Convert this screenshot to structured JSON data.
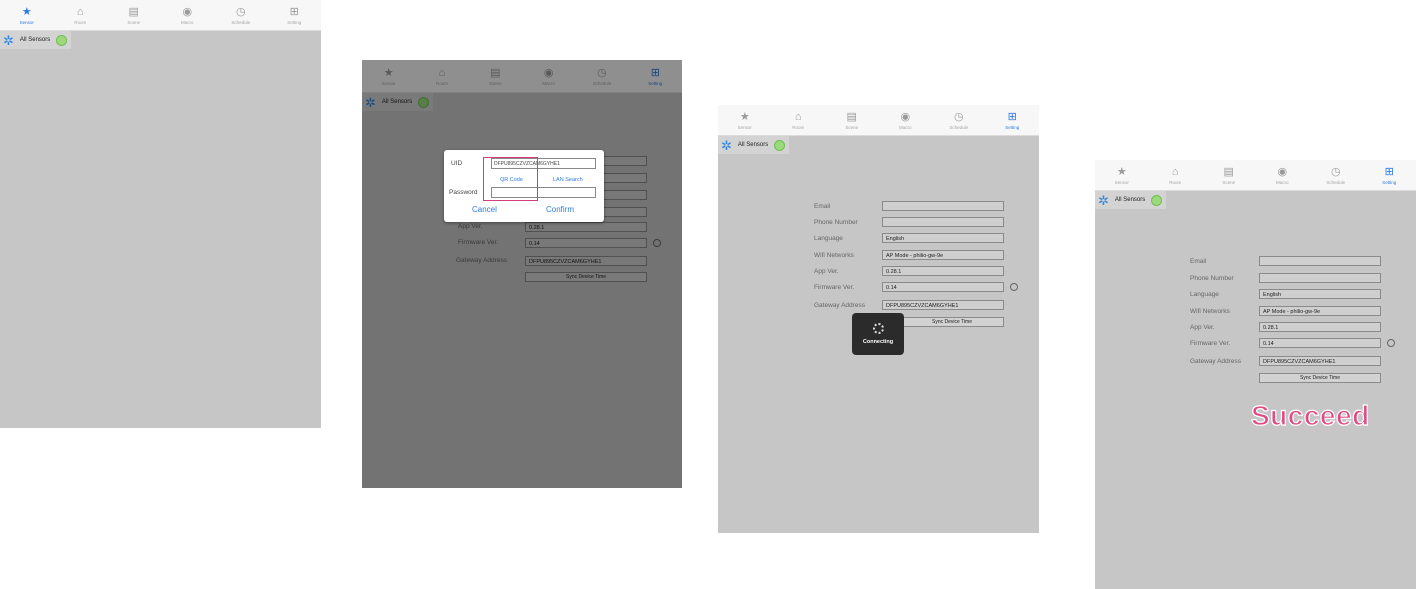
{
  "tabs": [
    {
      "label": "Sensor",
      "icon": "star-icon"
    },
    {
      "label": "Room",
      "icon": "house-icon"
    },
    {
      "label": "Scene",
      "icon": "scene-icon"
    },
    {
      "label": "Macro",
      "icon": "macro-icon"
    },
    {
      "label": "Schedule",
      "icon": "clock-icon"
    },
    {
      "label": "Setting",
      "icon": "setting-icon"
    }
  ],
  "header": {
    "title": "All Sensors"
  },
  "settings": {
    "email_label": "Email",
    "phone_label": "Phone Number",
    "language_label": "Language",
    "language_value": "English",
    "wifi_label": "Wifi Networks",
    "wifi_value": "AP Mode - philio-gw-9e",
    "app_ver_label": "App Ver.",
    "app_ver_value": "0.28.1",
    "firmware_label": "Firmware Ver.",
    "firmware_value": "0.14",
    "gateway_label": "Gateway Address",
    "gateway_value": "DFPU895CZVZCAM6GYHE1",
    "sync_button": "Sync Device Time"
  },
  "dialog": {
    "uid_label": "UID",
    "uid_value": "DFPU895CZVZCAM6GYHE1",
    "qr_code": "QR Code",
    "lan_search": "LAN Search",
    "password_label": "Password",
    "cancel": "Cancel",
    "confirm": "Confirm"
  },
  "hud": {
    "text": "Connecting"
  },
  "result": {
    "text": "Succeed"
  },
  "colors": {
    "accent": "#2c7be5",
    "highlight": "#d43c7e",
    "succeed": "#e04b86"
  }
}
